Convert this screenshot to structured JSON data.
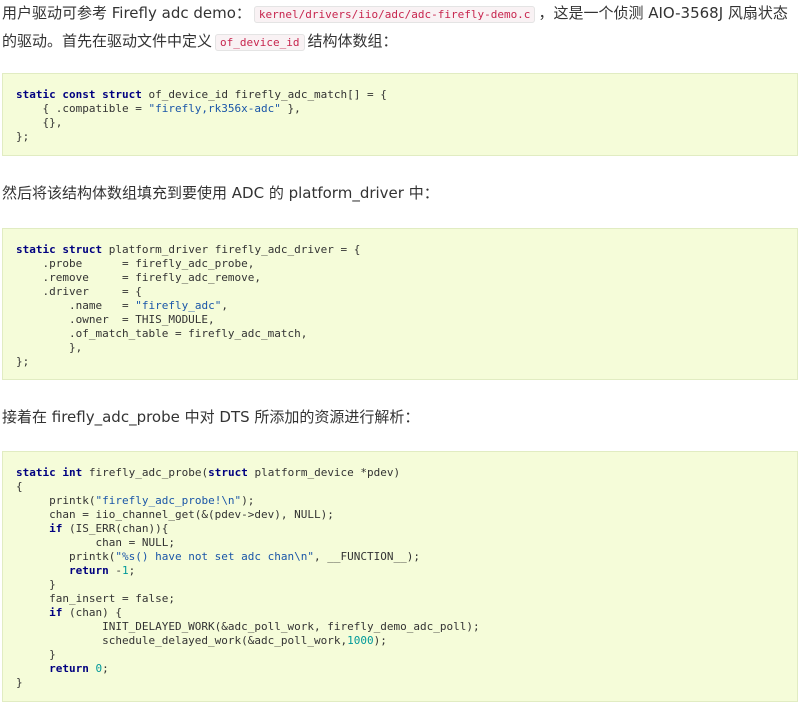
{
  "paragraphs": {
    "p1": {
      "t1": "用户驱动可参考 Firefly adc demo：",
      "code1": "kernel/drivers/iio/adc/adc-firefly-demo.c",
      "t2": "，这是一个侦测 AIO-3568J 风扇状态的驱动。首先在驱动文件中定义",
      "code2": "of_device_id",
      "t3": "结构体数组："
    },
    "p2": "然后将该结构体数组填充到要使用 ADC 的 platform_driver 中：",
    "p3": "接着在 firefly_adc_probe 中对 DTS 所添加的资源进行解析："
  },
  "code_blocks": {
    "block1": [
      "static const struct of_device_id firefly_adc_match[] = {",
      "    { .compatible = \"firefly,rk356x-adc\" },",
      "    {},",
      "};"
    ],
    "block2": [
      "static struct platform_driver firefly_adc_driver = {",
      "    .probe      = firefly_adc_probe,",
      "    .remove     = firefly_adc_remove,",
      "    .driver     = {",
      "        .name   = \"firefly_adc\",",
      "        .owner  = THIS_MODULE,",
      "        .of_match_table = firefly_adc_match,",
      "        },",
      "};"
    ],
    "block3": [
      "static int firefly_adc_probe(struct platform_device *pdev)",
      "{",
      "     printk(\"firefly_adc_probe!\\n\");",
      "     chan = iio_channel_get(&(pdev->dev), NULL);",
      "     if (IS_ERR(chan)){",
      "            chan = NULL;",
      "        printk(\"%s() have not set adc chan\\n\", __FUNCTION__);",
      "        return -1;",
      "     }",
      "     fan_insert = false;",
      "     if (chan) {",
      "             INIT_DELAYED_WORK(&adc_poll_work, firefly_demo_adc_poll);",
      "             schedule_delayed_work(&adc_poll_work,1000);",
      "     }",
      "     return 0;",
      "}"
    ]
  }
}
